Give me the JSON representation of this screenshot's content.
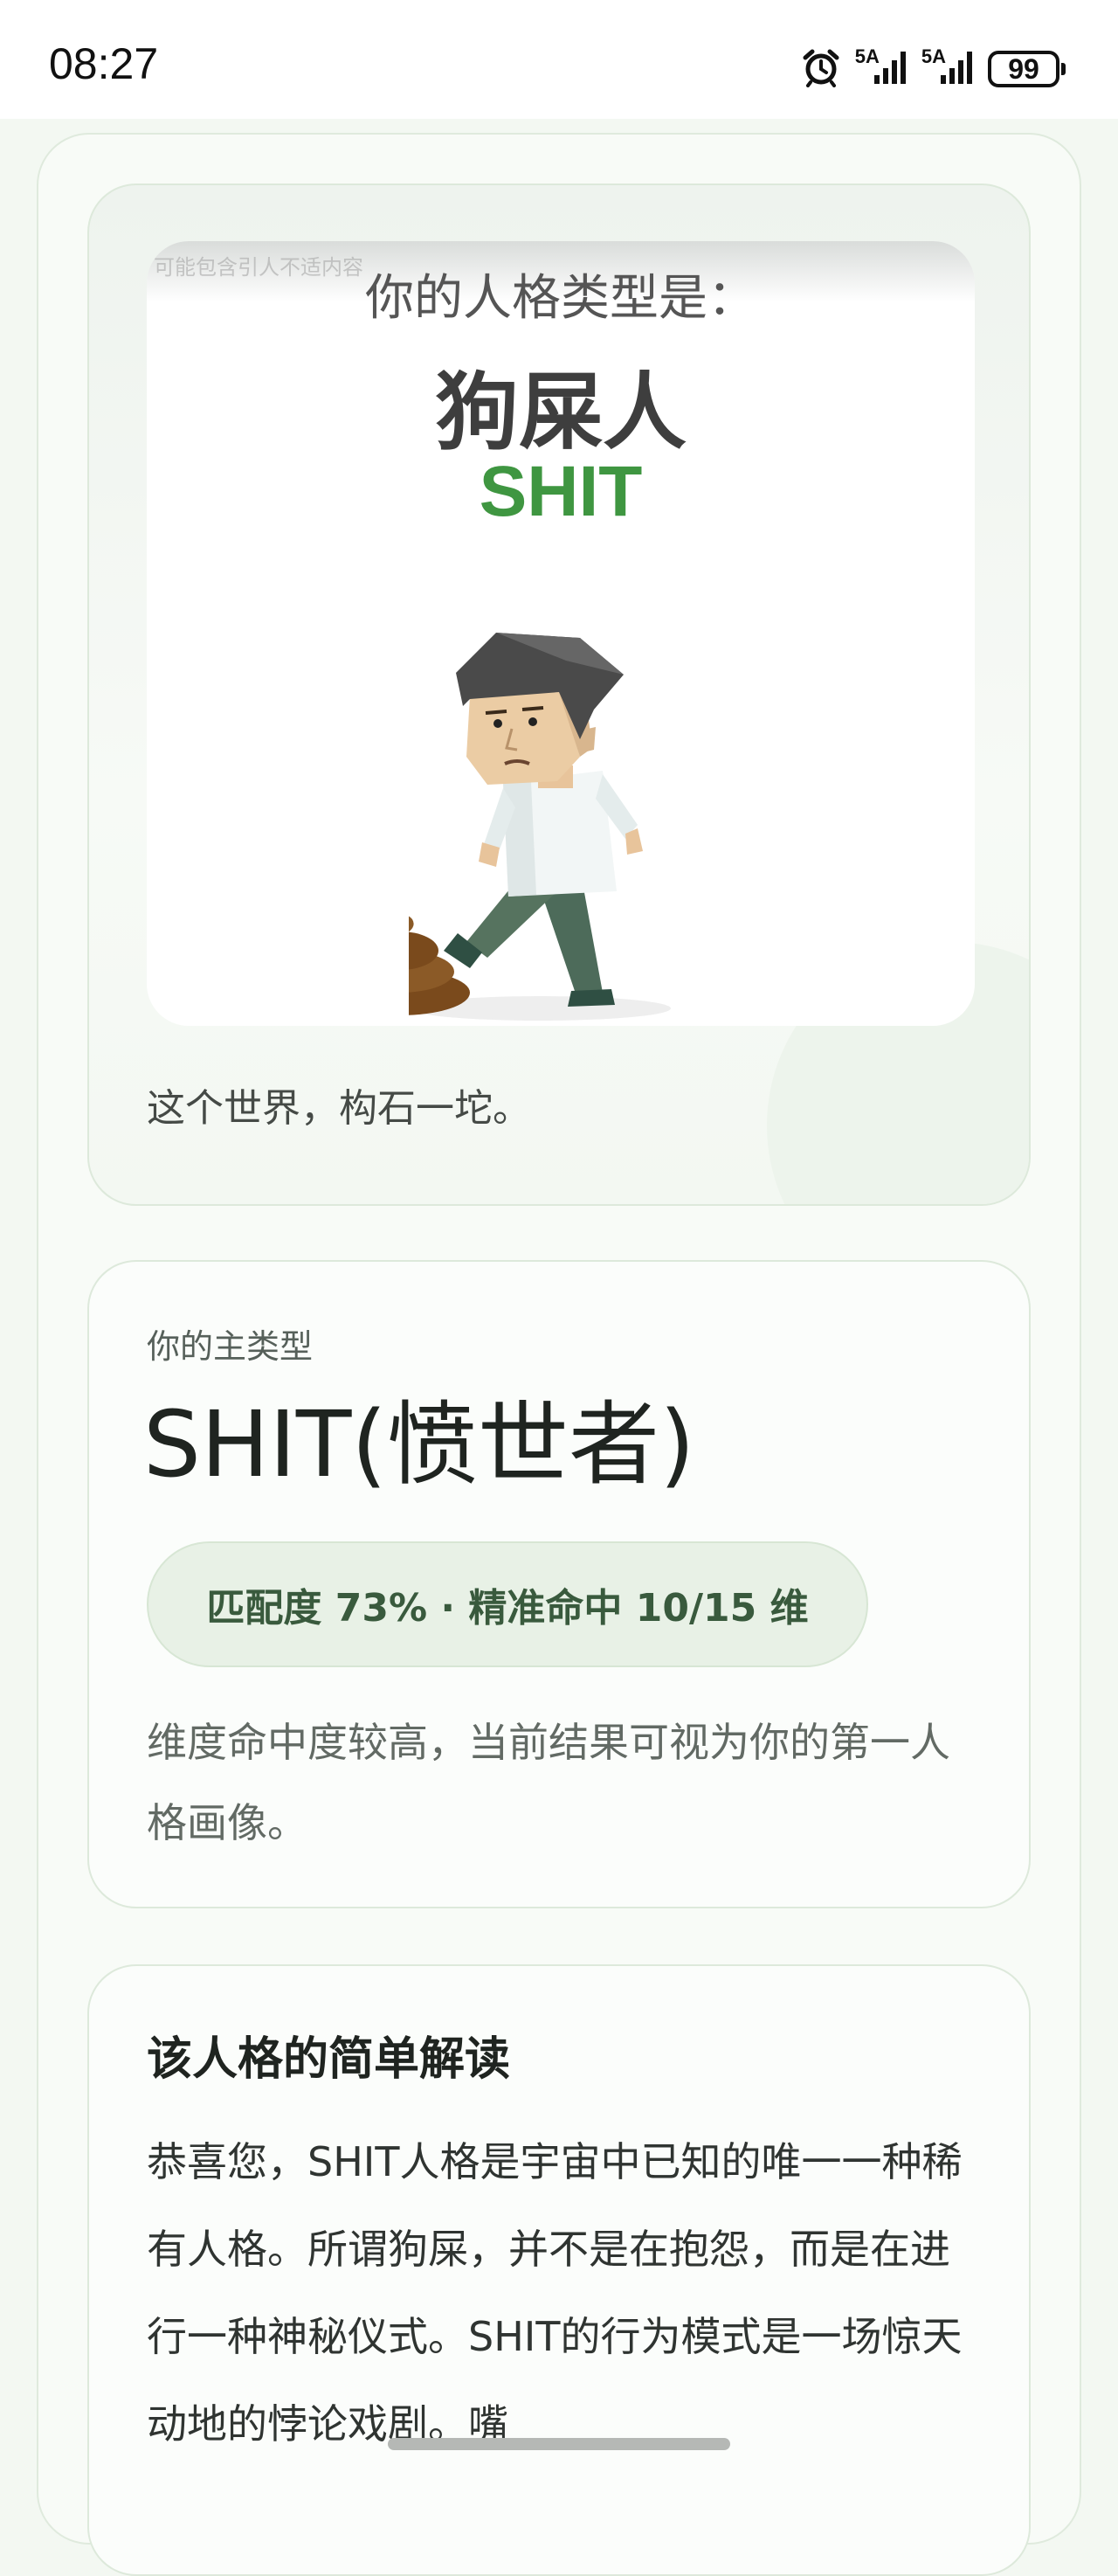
{
  "status_bar": {
    "time": "08:27",
    "network_1": "5A",
    "network_2": "5A",
    "battery": "99",
    "icons": [
      "alarm-icon",
      "signal-icon",
      "signal-icon",
      "battery-icon"
    ]
  },
  "hero": {
    "poster_watermark": "可能包含引人不适内容",
    "poster_heading": "你的人格类型是：",
    "poster_name": "狗屎人",
    "poster_code": "SHIT",
    "figure_icon": "kicking-poop-figure-icon",
    "caption": "这个世界，构石一坨。"
  },
  "main_type": {
    "eyebrow": "你的主类型",
    "title": "SHIT(愤世者)",
    "match": "匹配度 73% · 精准命中 10/15 维",
    "description": "维度命中度较高，当前结果可视为你的第一人格画像。"
  },
  "interpretation": {
    "title": "该人格的简单解读",
    "body": "恭喜您，SHIT人格是宇宙中已知的唯一一种稀有人格。所谓狗屎，并不是在抱怨，而是在进行一种神秘仪式。SHIT的行为模式是一场惊天动地的悖论戏剧。嘴"
  },
  "colors": {
    "accent_green": "#3f9641",
    "pill_bg": "#e8f1e6",
    "page_bg": "#f3f8f2"
  }
}
